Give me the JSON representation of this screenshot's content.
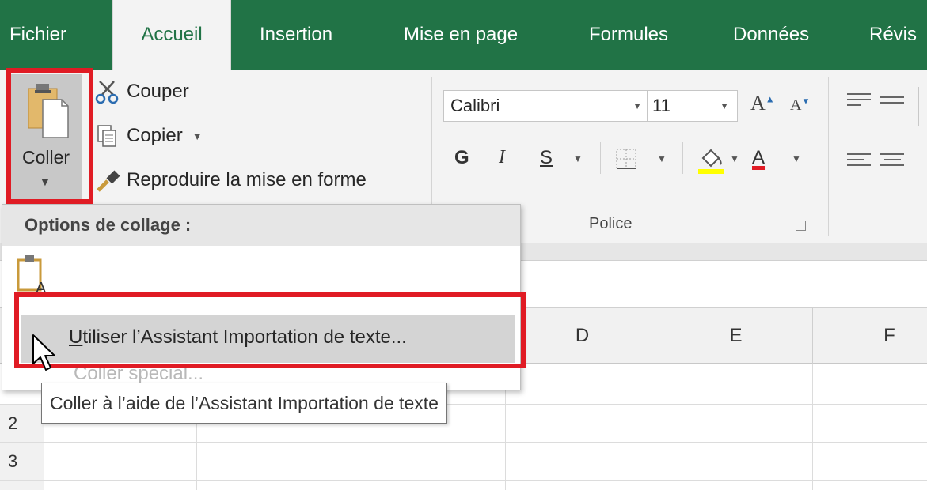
{
  "ribbon": {
    "tabs": [
      {
        "label": "Fichier",
        "active": false
      },
      {
        "label": "Accueil",
        "active": true
      },
      {
        "label": "Insertion",
        "active": false
      },
      {
        "label": "Mise en page",
        "active": false
      },
      {
        "label": "Formules",
        "active": false
      },
      {
        "label": "Données",
        "active": false
      },
      {
        "label": "Révis",
        "active": false
      }
    ],
    "accent_color": "#217346"
  },
  "clipboard": {
    "paste_label": "Coller",
    "cut_label": "Couper",
    "copy_label": "Copier",
    "format_painter_label": "Reproduire la mise en forme"
  },
  "font_group": {
    "font_name": "Calibri",
    "font_size": "11",
    "bold_label": "G",
    "italic_label": "I",
    "underline_label": "S",
    "group_label": "Police",
    "grow_label": "A",
    "shrink_label": "A",
    "font_color_label": "A"
  },
  "paste_menu": {
    "header": "Options de collage :",
    "paste_icon_letter": "A",
    "item_underlined": "U",
    "item_rest": "tiliser l’Assistant Importation de texte...",
    "ghost_item": "Coller spécial..."
  },
  "tooltip": {
    "text": "Coller à l’aide de l’Assistant Importation de texte"
  },
  "grid": {
    "columns": [
      "D",
      "E",
      "F"
    ],
    "rows": [
      "2",
      "3"
    ]
  },
  "highlight_color": "#e01b24"
}
